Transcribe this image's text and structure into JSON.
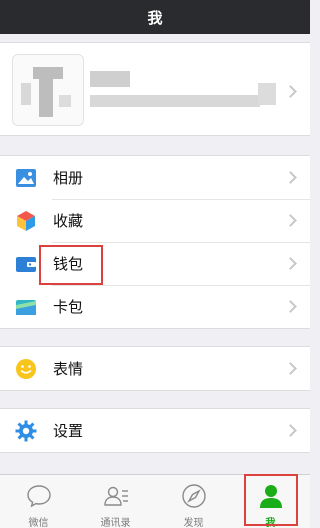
{
  "header": {
    "title": "我"
  },
  "menu": {
    "group1": [
      {
        "label": "相册",
        "icon": "photo-album-icon"
      },
      {
        "label": "收藏",
        "icon": "favorites-cube-icon"
      },
      {
        "label": "钱包",
        "icon": "wallet-icon"
      },
      {
        "label": "卡包",
        "icon": "card-package-icon"
      }
    ],
    "group2": [
      {
        "label": "表情",
        "icon": "smiley-icon"
      }
    ],
    "group3": [
      {
        "label": "设置",
        "icon": "gear-icon"
      }
    ]
  },
  "tabbar": {
    "items": [
      {
        "label": "微信",
        "icon": "chat-bubble-icon"
      },
      {
        "label": "通讯录",
        "icon": "contacts-icon"
      },
      {
        "label": "发现",
        "icon": "compass-icon"
      },
      {
        "label": "我",
        "icon": "person-icon",
        "active": true
      }
    ]
  },
  "colors": {
    "accent": "#1aad19",
    "highlight": "#d9423d",
    "navbar": "#2a2b2e"
  }
}
